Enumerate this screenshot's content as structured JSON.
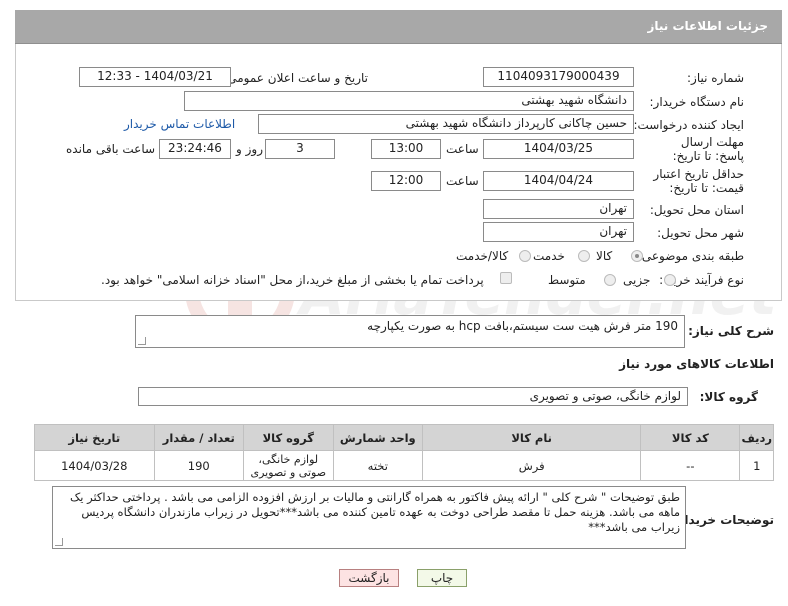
{
  "panel": {
    "title": "جزئیات اطلاعات نیاز"
  },
  "watermark": {
    "text": "AriaTender.net"
  },
  "fields": {
    "need_number_label": "شماره نیاز:",
    "need_number": "1104093179000439",
    "announce_label": "تاریخ و ساعت اعلان عمومی:",
    "announce_value": "1404/03/21 - 12:33",
    "buyer_org_label": "نام دستگاه خریدار:",
    "buyer_org": "دانشگاه شهید بهشتی",
    "requester_label": "ایجاد کننده درخواست:",
    "requester": "حسین چاکانی کارپرداز دانشگاه شهید بهشتی",
    "buyer_contact_link": "اطلاعات تماس خریدار",
    "reply_deadline_label": "مهلت ارسال پاسخ: تا تاریخ:",
    "reply_date": "1404/03/25",
    "hour_label": "ساعت",
    "reply_time": "13:00",
    "reply_days": "3",
    "days_and_label": "روز و",
    "countdown": "23:24:46",
    "remaining_label": "ساعت باقی مانده",
    "price_validity_label": "حداقل تاریخ اعتبار قیمت: تا تاریخ:",
    "validity_date": "1404/04/24",
    "validity_time": "12:00",
    "province_label": "استان محل تحویل:",
    "province": "تهران",
    "city_label": "شهر محل تحویل:",
    "city": "تهران",
    "category_label": "طبقه بندی موضوعی:",
    "category_options": [
      "کالا",
      "خدمت",
      "کالا/خدمت"
    ],
    "process_label": "نوع فرآیند خرید :",
    "process_options": [
      "جزیی",
      "متوسط"
    ],
    "payment_note": "پرداخت تمام یا بخشی از مبلغ خرید،از محل \"اسناد خزانه اسلامی\" خواهد بود."
  },
  "general_desc": {
    "label": "شرح کلی نیاز:",
    "value": "190 متر فرش هیت ست سیستم،بافت hcp به صورت یکپارچه"
  },
  "goods_info": {
    "heading": "اطلاعات کالاهای مورد نیاز",
    "group_label": "گروه کالا:",
    "group_value": "لوازم خانگی، صوتی و تصویری"
  },
  "table": {
    "headers": [
      "ردیف",
      "کد کالا",
      "نام کالا",
      "واحد شمارش",
      "گروه کالا",
      "تعداد / مقدار",
      "تاریخ نیاز"
    ],
    "rows": [
      [
        "1",
        "--",
        "فرش",
        "تخته",
        "لوازم خانگی، صوتی و تصویری",
        "190",
        "1404/03/28"
      ]
    ]
  },
  "buyer_notes": {
    "label": "توضیحات خریدار:",
    "text": "طبق توضیحات \" شرح کلی \"  ارائه پیش فاکتور به همراه گارانتی و مالیات بر ارزش افزوده الزامی می باشد . پرداختی حداکثر یک ماهه می باشد. هزینه حمل تا مقصد طراحی دوخت به عهده تامین کننده می باشد***تحویل در زیراب مازندران دانشگاه پردیس زیراب می باشد***"
  },
  "buttons": {
    "print": "چاپ",
    "back": "بازگشت"
  }
}
